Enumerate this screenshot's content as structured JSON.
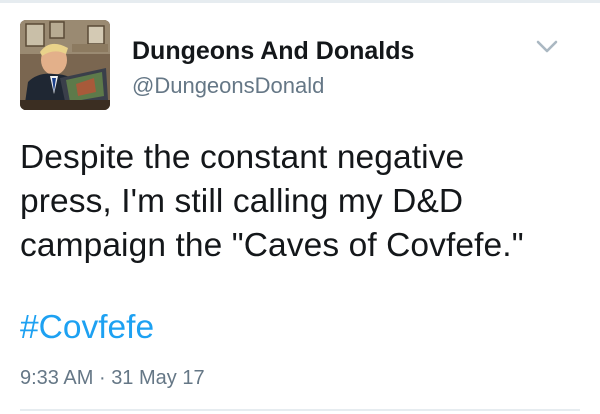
{
  "tweet": {
    "display_name": "Dungeons And Donalds",
    "handle": "@DungeonsDonald",
    "avatar_icon": "profile-photo",
    "menu_icon": "chevron-down-icon",
    "text_lines": [
      "Despite the constant negative",
      "press, I'm still calling my D&D",
      "campaign the \"Caves of Covfefe.\""
    ],
    "hashtag": "#Covfefe",
    "time": "9:33 AM",
    "separator": "·",
    "date": "31 May 17"
  },
  "colors": {
    "text": "#14171a",
    "secondary": "#657786",
    "link": "#1da1f2",
    "divider": "#e6ecf0"
  }
}
